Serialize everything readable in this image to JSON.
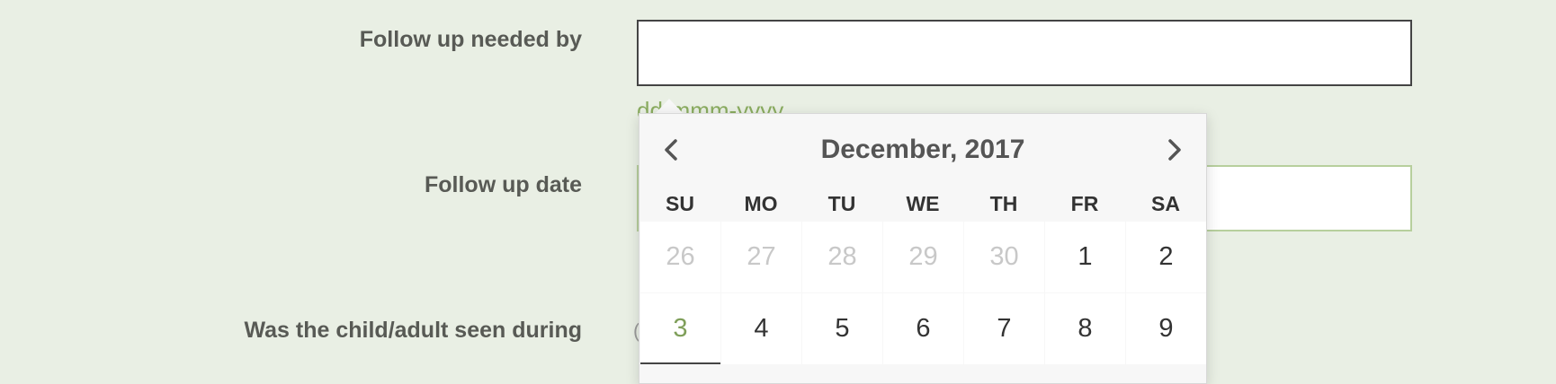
{
  "form": {
    "followup_needed_label": "Follow up needed by",
    "followup_needed_value": "",
    "date_hint": "dd-mmm-yyyy",
    "followup_date_label": "Follow up date",
    "followup_date_value": "",
    "seen_label": "Was the child/adult seen during"
  },
  "datepicker": {
    "title": "December, 2017",
    "weekdays": [
      "SU",
      "MO",
      "TU",
      "WE",
      "TH",
      "FR",
      "SA"
    ],
    "weeks": [
      [
        {
          "d": "26",
          "muted": true
        },
        {
          "d": "27",
          "muted": true
        },
        {
          "d": "28",
          "muted": true
        },
        {
          "d": "29",
          "muted": true
        },
        {
          "d": "30",
          "muted": true
        },
        {
          "d": "1",
          "muted": false
        },
        {
          "d": "2",
          "muted": false
        }
      ],
      [
        {
          "d": "3",
          "muted": false,
          "today": true
        },
        {
          "d": "4",
          "muted": false
        },
        {
          "d": "5",
          "muted": false
        },
        {
          "d": "6",
          "muted": false
        },
        {
          "d": "7",
          "muted": false
        },
        {
          "d": "8",
          "muted": false
        },
        {
          "d": "9",
          "muted": false
        }
      ]
    ]
  }
}
